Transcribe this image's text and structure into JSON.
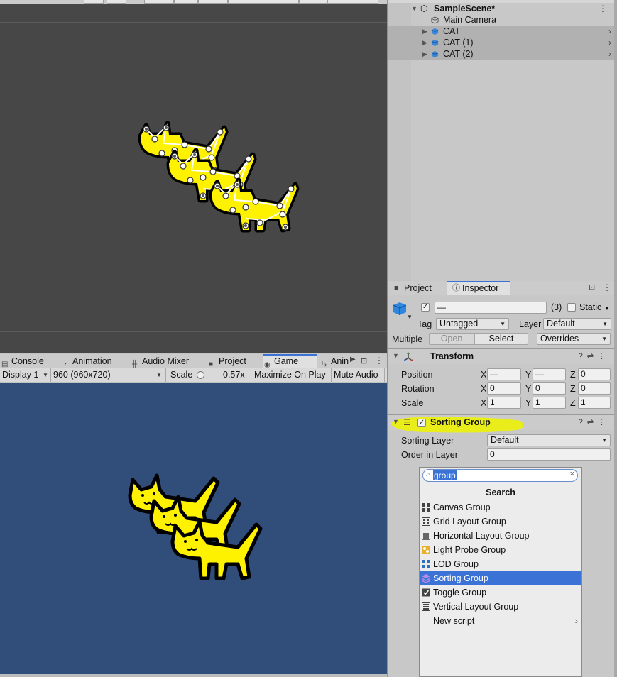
{
  "scene": {
    "toolbar_slot_count": 8
  },
  "bottom_tabs": [
    {
      "label": "Console",
      "icon": "console-icon"
    },
    {
      "label": "Animation",
      "icon": "animation-icon"
    },
    {
      "label": "Audio Mixer",
      "icon": "audio-mixer-icon"
    },
    {
      "label": "Project",
      "icon": "folder-icon"
    },
    {
      "label": "Game",
      "icon": "gamepad-icon",
      "active": true
    },
    {
      "label": "Anin",
      "icon": "animator-icon"
    }
  ],
  "game_toolbar": {
    "display": "Display 1",
    "resolution": "960 (960x720)",
    "scale_label": "Scale",
    "scale_value": "0.57x",
    "maximize": "Maximize On Play",
    "mute": "Mute Audio"
  },
  "hierarchy": {
    "scene_name": "SampleScene*",
    "items": [
      {
        "name": "Main Camera",
        "selected": false
      },
      {
        "name": "CAT",
        "selected": true
      },
      {
        "name": "CAT (1)",
        "selected": true
      },
      {
        "name": "CAT (2)",
        "selected": true
      }
    ]
  },
  "panel_tabs": {
    "project": "Project",
    "inspector": "Inspector"
  },
  "inspector": {
    "name_value": "—",
    "count": "(3)",
    "static_label": "Static",
    "tag_label": "Tag",
    "tag_value": "Untagged",
    "layer_label": "Layer",
    "layer_value": "Default",
    "multiple_label": "Multiple",
    "open_label": "Open",
    "select_label": "Select",
    "overrides_label": "Overrides",
    "transform": {
      "title": "Transform",
      "position_label": "Position",
      "rotation_label": "Rotation",
      "scale_label": "Scale",
      "axis_x": "X",
      "axis_y": "Y",
      "axis_z": "Z",
      "position": {
        "x": "—",
        "y": "—",
        "z": "0"
      },
      "rotation": {
        "x": "0",
        "y": "0",
        "z": "0"
      },
      "scale": {
        "x": "1",
        "y": "1",
        "z": "1"
      }
    },
    "sorting_group": {
      "title": "Sorting Group",
      "sorting_layer_label": "Sorting Layer",
      "sorting_layer_value": "Default",
      "order_label": "Order in Layer",
      "order_value": "0",
      "highlight_color": "#e9ee1a"
    }
  },
  "add_component": {
    "search_value": "group",
    "header": "Search",
    "items": [
      {
        "label": "Canvas Group",
        "icon": "canvas-group-icon"
      },
      {
        "label": "Grid Layout Group",
        "icon": "grid-layout-icon"
      },
      {
        "label": "Horizontal Layout Group",
        "icon": "horizontal-layout-icon"
      },
      {
        "label": "Light Probe Group",
        "icon": "light-probe-icon"
      },
      {
        "label": "LOD Group",
        "icon": "lod-group-icon"
      },
      {
        "label": "Sorting Group",
        "icon": "sorting-group-icon",
        "highlighted": true
      },
      {
        "label": "Toggle Group",
        "icon": "toggle-group-icon"
      },
      {
        "label": "Vertical Layout Group",
        "icon": "vertical-layout-icon"
      },
      {
        "label": "New script",
        "icon": "",
        "submenu": true
      }
    ]
  },
  "colors": {
    "accent": "#3a72d6",
    "scene_bg": "#474747",
    "game_bg": "#314d79",
    "cat_yellow": "#fff200"
  }
}
